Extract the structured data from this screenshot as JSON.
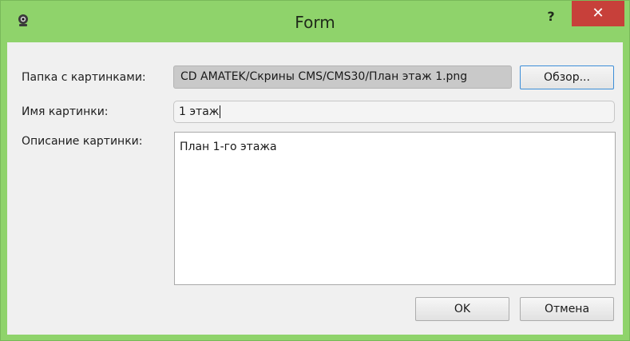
{
  "window": {
    "title": "Form",
    "help_label": "?",
    "close_label": "✕",
    "accent_color": "#8fd36b",
    "close_color": "#c7403a"
  },
  "form": {
    "folder_label": "Папка с картинками:",
    "folder_path": "CD AMATEK/Скрины CMS/CMS30/План этаж 1.png",
    "browse_label": "Обзор...",
    "name_label": "Имя картинки:",
    "name_value": "1 этаж",
    "description_label": "Описание картинки:",
    "description_value": "План 1-го этажа"
  },
  "buttons": {
    "ok_label": "OK",
    "cancel_label": "Отмена"
  },
  "icons": {
    "app": "webcam-icon"
  }
}
